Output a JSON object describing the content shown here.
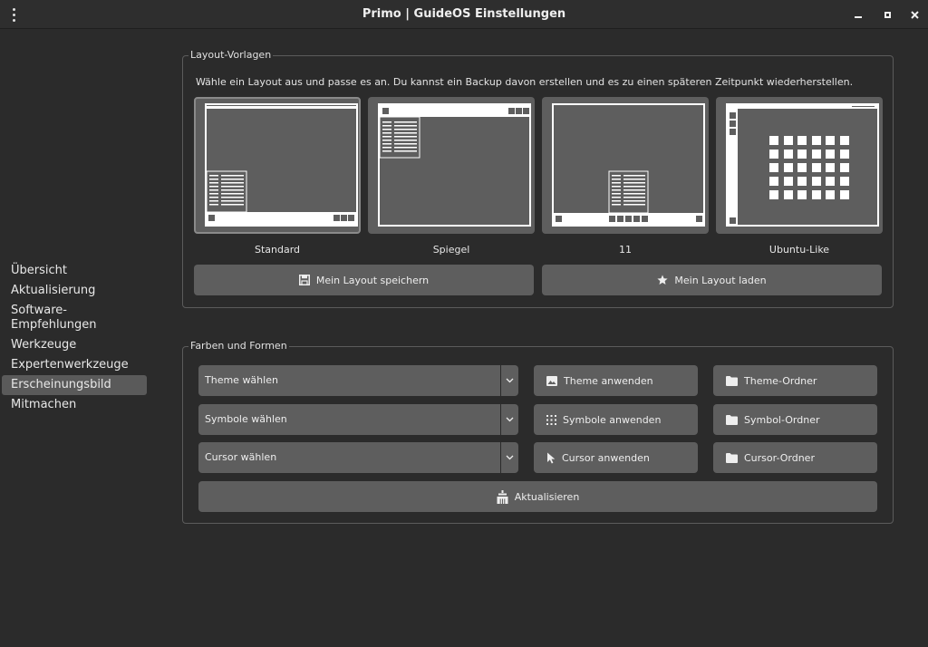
{
  "window": {
    "title": "Primo | GuideOS Einstellungen"
  },
  "sidebar": {
    "items": [
      {
        "label": "Übersicht"
      },
      {
        "label": "Aktualisierung"
      },
      {
        "label": "Software-\nEmpfehlungen"
      },
      {
        "label": "Werkzeuge"
      },
      {
        "label": "Expertenwerkzeuge"
      },
      {
        "label": "Erscheinungsbild",
        "active": true
      },
      {
        "label": "Mitmachen"
      }
    ]
  },
  "layout_section": {
    "title": "Layout-Vorlagen",
    "description": "Wähle ein Layout aus und passe es an. Du kannst ein Backup davon erstellen und es zu einen späteren Zeitpunkt wiederherstellen.",
    "layouts": [
      {
        "name": "Standard",
        "selected": true
      },
      {
        "name": "Spiegel"
      },
      {
        "name": "11"
      },
      {
        "name": "Ubuntu-Like"
      }
    ],
    "save_button": "Mein Layout speichern",
    "load_button": "Mein Layout laden"
  },
  "colors_section": {
    "title": "Farben und Formen",
    "theme_combo": "Theme wählen",
    "icons_combo": "Symbole wählen",
    "cursor_combo": "Cursor wählen",
    "apply_theme": "Theme anwenden",
    "apply_icons": "Symbole anwenden",
    "apply_cursor": "Cursor anwenden",
    "theme_folder": "Theme-Ordner",
    "icons_folder": "Symbol-Ordner",
    "cursor_folder": "Cursor-Ordner",
    "refresh_button": "Aktualisieren"
  },
  "colors": {
    "background": "#2b2b2b",
    "button": "#5e5e5e",
    "selected_sidebar": "#5a5a5a"
  }
}
